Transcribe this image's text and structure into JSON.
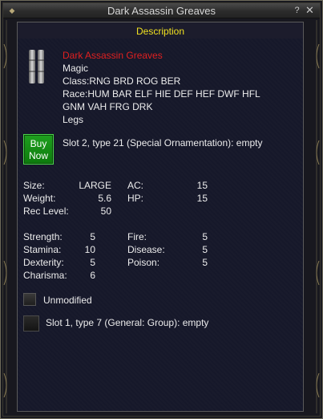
{
  "window": {
    "title": "Dark Assassin Greaves",
    "help": "?",
    "close": "✕"
  },
  "tab": {
    "label": "Description"
  },
  "item": {
    "icon": "greaves-icon",
    "name": "Dark Assassin Greaves",
    "lines": [
      "Magic",
      "Class:RNG BRD ROG BER",
      "Race:HUM BAR ELF HIE DEF HEF DWF HFL",
      "GNM VAH FRG DRK",
      "Legs"
    ]
  },
  "buy_button": {
    "line1": "Buy",
    "line2": "Now"
  },
  "slot2": {
    "text": "Slot 2, type 21 (Special Ornamentation): empty"
  },
  "stats_top": {
    "size_label": "Size:",
    "size_value": "LARGE",
    "weight_label": "Weight:",
    "weight_value": "5.6",
    "rec_label": "Rec Level:",
    "rec_value": "50",
    "ac_label": "AC:",
    "ac_value": "15",
    "hp_label": "HP:",
    "hp_value": "15"
  },
  "stats_attr": {
    "str_label": "Strength:",
    "str_value": "5",
    "sta_label": "Stamina:",
    "sta_value": "10",
    "dex_label": "Dexterity:",
    "dex_value": "5",
    "cha_label": "Charisma:",
    "cha_value": "6",
    "fire_label": "Fire:",
    "fire_value": "5",
    "disease_label": "Disease:",
    "disease_value": "5",
    "poison_label": "Poison:",
    "poison_value": "5"
  },
  "unmodified": {
    "label": "Unmodified",
    "checked": false
  },
  "slot1": {
    "text": "Slot 1, type 7 (General: Group): empty"
  },
  "colors": {
    "item_name": "#e02020",
    "tab_label": "#f0e020",
    "buy_button": "#1a9a1a",
    "panel_bg": "#16182a"
  }
}
